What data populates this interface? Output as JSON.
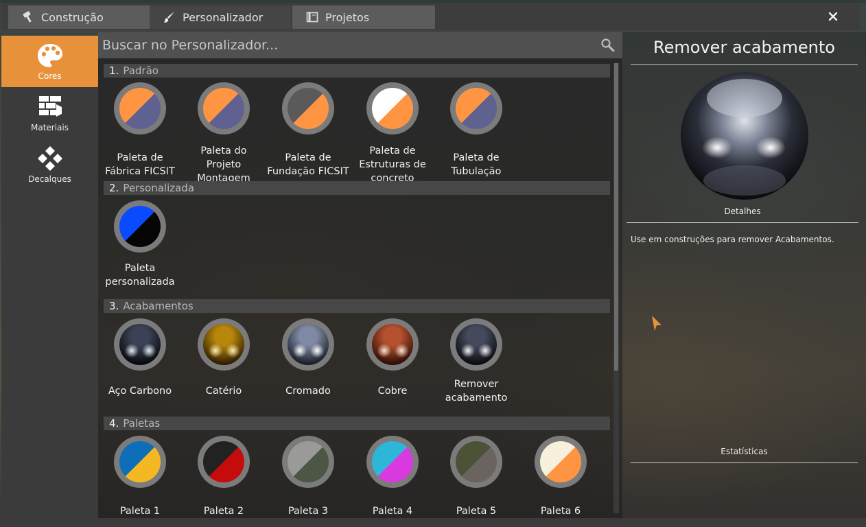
{
  "tabs": [
    {
      "label": "Construção",
      "icon": "hammer-icon"
    },
    {
      "label": "Personalizador",
      "icon": "brush-icon"
    },
    {
      "label": "Projetos",
      "icon": "blueprint-icon"
    }
  ],
  "close_icon": "close-icon",
  "categories": [
    {
      "label": "Cores",
      "icon": "palette-icon",
      "active": true
    },
    {
      "label": "Materiais",
      "icon": "bricks-icon",
      "active": false
    },
    {
      "label": "Decalques",
      "icon": "decals-icon",
      "active": false
    }
  ],
  "search": {
    "placeholder": "Buscar no Personalizador...",
    "value": "",
    "icon": "search-icon"
  },
  "sections": [
    {
      "num": "1.",
      "name": "Padrão",
      "items": [
        {
          "label": "Paleta de Fábrica FICSIT",
          "colors": [
            "#ff9543",
            "#5f6191"
          ]
        },
        {
          "label": "Paleta do Projeto Montagem",
          "colors": [
            "#ff9543",
            "#5f6191"
          ]
        },
        {
          "label": "Paleta de Fundação FICSIT",
          "colors": [
            "#5a5a5a",
            "#ff9543"
          ]
        },
        {
          "label": "Paleta de Estruturas de concreto",
          "colors": [
            "#ffffff",
            "#ff9543"
          ]
        },
        {
          "label": "Paleta de Tubulação",
          "colors": [
            "#ff9543",
            "#5f6191"
          ]
        }
      ]
    },
    {
      "num": "2.",
      "name": "Personalizada",
      "items": [
        {
          "label": "Paleta personalizada",
          "colors": [
            "#0a4bff",
            "#050505"
          ]
        }
      ]
    },
    {
      "num": "3.",
      "name": "Acabamentos",
      "items": [
        {
          "label": "Aço Carbono",
          "finish": [
            "#e8ecf3",
            "#3b4256",
            "#07080c"
          ]
        },
        {
          "label": "Catério",
          "finish": [
            "#fff2b0",
            "#b8860b",
            "#2a1a02"
          ]
        },
        {
          "label": "Cromado",
          "finish": [
            "#ffffff",
            "#7f89a3",
            "#171b26"
          ]
        },
        {
          "label": "Cobre",
          "finish": [
            "#ffe2d2",
            "#b5512e",
            "#2a0c05"
          ]
        },
        {
          "label": "Remover acabamento",
          "finish": [
            "#f4f4f4",
            "#444a5c",
            "#0a0a0d"
          ]
        }
      ]
    },
    {
      "num": "4.",
      "name": "Paletas",
      "items": [
        {
          "label": "Paleta 1",
          "colors": [
            "#0e6eb8",
            "#f4b822"
          ]
        },
        {
          "label": "Paleta 2",
          "colors": [
            "#222222",
            "#c40c0c"
          ]
        },
        {
          "label": "Paleta 3",
          "colors": [
            "#9a9a98",
            "#4d5545"
          ]
        },
        {
          "label": "Paleta 4",
          "colors": [
            "#2eb6d8",
            "#d83adf"
          ]
        },
        {
          "label": "Paleta 5",
          "colors": [
            "#4c5236",
            "#6a6460"
          ]
        },
        {
          "label": "Paleta 6",
          "colors": [
            "#f6f0dc",
            "#ff9543"
          ]
        }
      ]
    }
  ],
  "detail": {
    "title": "Remover acabamento",
    "details_label": "Detalhes",
    "description": "Use em construções para remover Acabamentos.",
    "stats_label": "Estatísticas"
  },
  "accent": "#e8913b"
}
